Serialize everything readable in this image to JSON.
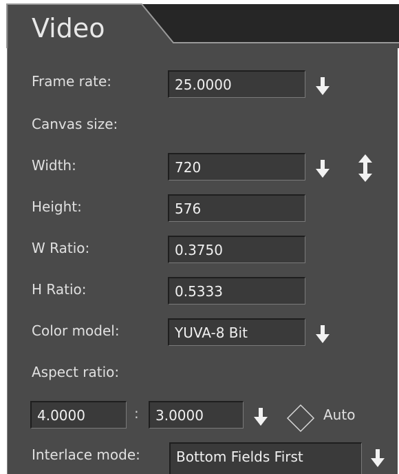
{
  "tab": {
    "label": "Video"
  },
  "frame_rate": {
    "label": "Frame rate:",
    "value": "25.0000"
  },
  "canvas_size": {
    "label": "Canvas size:"
  },
  "width": {
    "label": "Width:",
    "value": "720"
  },
  "height": {
    "label": "Height:",
    "value": "576"
  },
  "w_ratio": {
    "label": "W Ratio:",
    "value": "0.3750"
  },
  "h_ratio": {
    "label": "H Ratio:",
    "value": "0.5333"
  },
  "color_model": {
    "label": "Color model:",
    "value": "YUVA-8 Bit"
  },
  "aspect_ratio": {
    "label": "Aspect ratio:",
    "w_value": "4.0000",
    "separator": ":",
    "h_value": "3.0000",
    "auto_label": "Auto"
  },
  "interlace": {
    "label": "Interlace mode:",
    "value": "Bottom Fields First"
  },
  "icons": {
    "dropdown": "arrow-down-icon",
    "swap": "swap-vertical-icon",
    "checkbox": "diamond-checkbox-icon"
  },
  "colors": {
    "panel": "#4a4a4a",
    "field": "#3a3a3a",
    "text": "#e0e0e0"
  }
}
